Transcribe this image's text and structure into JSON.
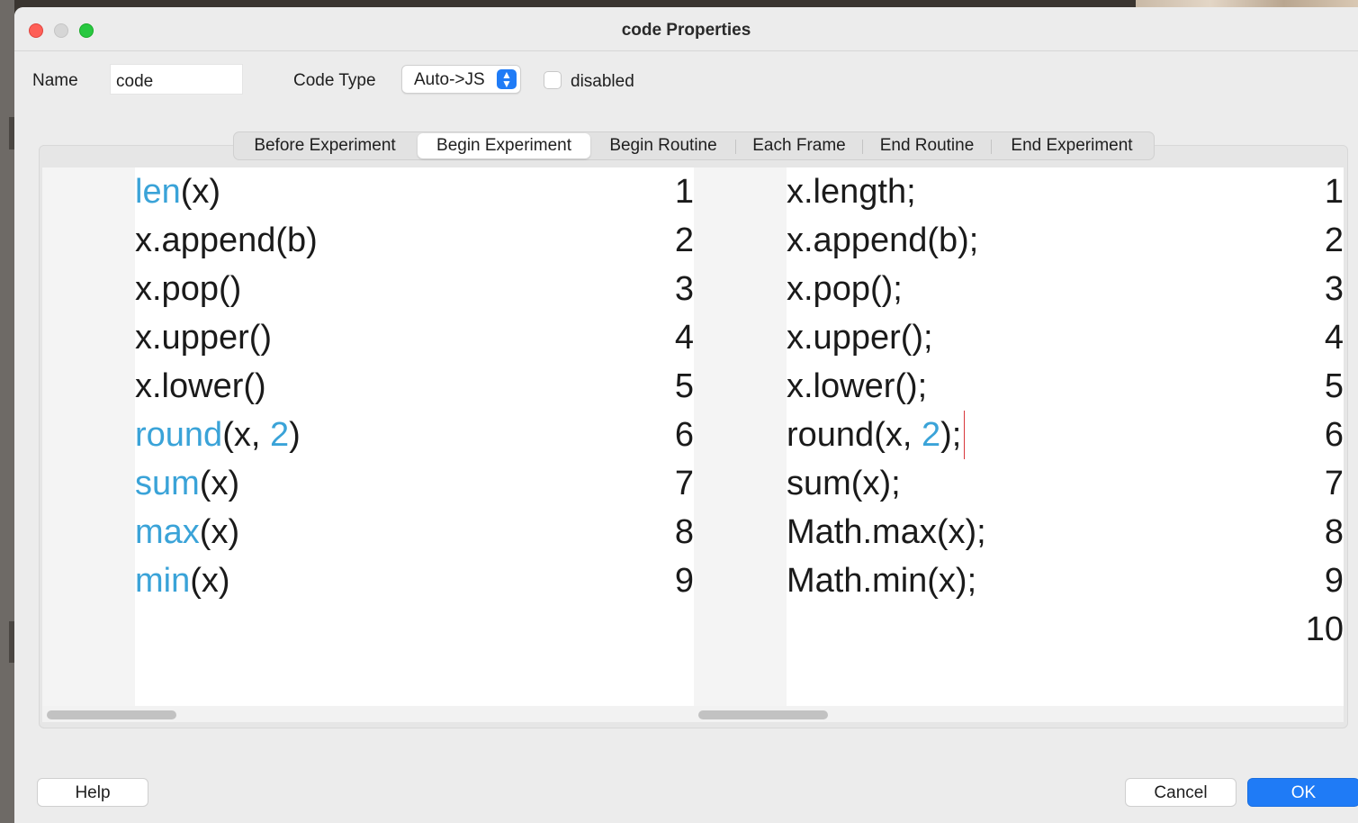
{
  "window": {
    "title": "code Properties"
  },
  "form": {
    "name_label": "Name",
    "name_value": "code",
    "code_type_label": "Code Type",
    "code_type_value": "Auto->JS",
    "disabled_label": "disabled",
    "disabled_checked": false
  },
  "tabs": [
    {
      "label": "Before Experiment",
      "active": false
    },
    {
      "label": "Begin Experiment",
      "active": true
    },
    {
      "label": "Begin Routine",
      "active": false
    },
    {
      "label": "Each Frame",
      "active": false
    },
    {
      "label": "End Routine",
      "active": false
    },
    {
      "label": "End Experiment",
      "active": false
    }
  ],
  "python_editor": {
    "lines": [
      {
        "num": "1",
        "tokens": [
          {
            "t": "len",
            "kw": true
          },
          {
            "t": "(x)"
          }
        ]
      },
      {
        "num": "2",
        "tokens": [
          {
            "t": "x.append(b)"
          }
        ]
      },
      {
        "num": "3",
        "tokens": [
          {
            "t": "x.pop()"
          }
        ]
      },
      {
        "num": "4",
        "tokens": [
          {
            "t": "x.upper()"
          }
        ]
      },
      {
        "num": "5",
        "tokens": [
          {
            "t": "x.lower()"
          }
        ]
      },
      {
        "num": "6",
        "tokens": [
          {
            "t": "round",
            "kw": true
          },
          {
            "t": "(x, "
          },
          {
            "t": "2",
            "kw": true
          },
          {
            "t": ")"
          }
        ]
      },
      {
        "num": "7",
        "tokens": [
          {
            "t": "sum",
            "kw": true
          },
          {
            "t": "(x)"
          }
        ]
      },
      {
        "num": "8",
        "tokens": [
          {
            "t": "max",
            "kw": true
          },
          {
            "t": "(x)"
          }
        ]
      },
      {
        "num": "9",
        "tokens": [
          {
            "t": "min",
            "kw": true
          },
          {
            "t": "(x)"
          }
        ]
      }
    ]
  },
  "js_editor": {
    "lines": [
      {
        "num": "1",
        "tokens": [
          {
            "t": "x.length;"
          }
        ]
      },
      {
        "num": "2",
        "tokens": [
          {
            "t": "x.append(b);"
          }
        ]
      },
      {
        "num": "3",
        "tokens": [
          {
            "t": "x.pop();"
          }
        ]
      },
      {
        "num": "4",
        "tokens": [
          {
            "t": "x.upper();"
          }
        ]
      },
      {
        "num": "5",
        "tokens": [
          {
            "t": "x.lower();"
          }
        ]
      },
      {
        "num": "6",
        "tokens": [
          {
            "t": "round(x, "
          },
          {
            "t": "2",
            "kw": true
          },
          {
            "t": ");"
          }
        ]
      },
      {
        "num": "7",
        "tokens": [
          {
            "t": "sum(x);"
          }
        ]
      },
      {
        "num": "8",
        "tokens": [
          {
            "t": "Math.max(x);"
          }
        ]
      },
      {
        "num": "9",
        "tokens": [
          {
            "t": "Math.min(x);"
          }
        ]
      },
      {
        "num": "10",
        "tokens": []
      }
    ]
  },
  "buttons": {
    "help": "Help",
    "cancel": "Cancel",
    "ok": "OK"
  },
  "colors": {
    "keyword": "#3aa3d8",
    "accent": "#1f7bf6",
    "caret": "#d8373b"
  },
  "icons": {
    "code_type_select": "up-down-chevron-icon"
  }
}
